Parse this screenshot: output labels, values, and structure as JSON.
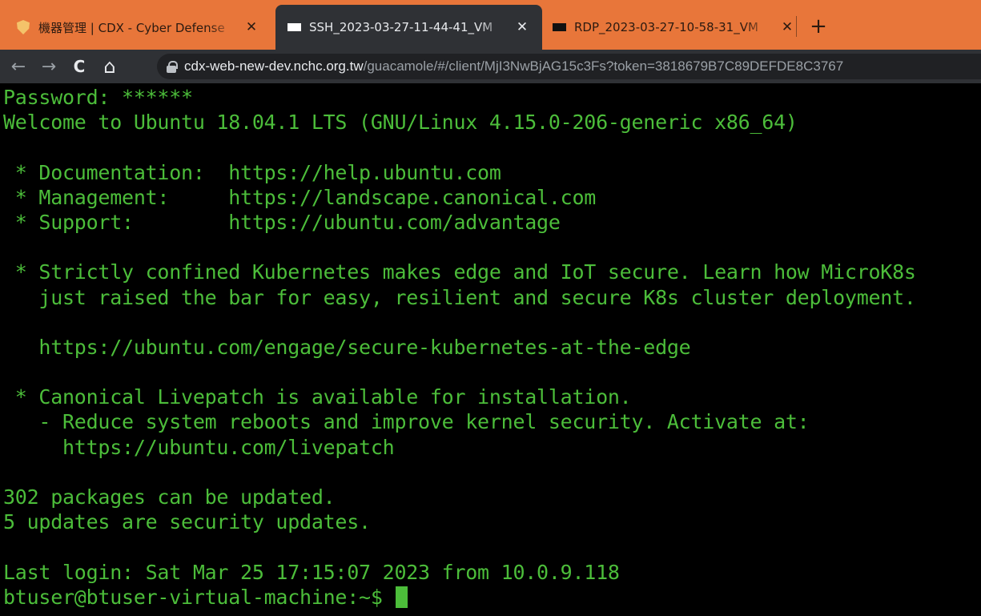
{
  "browser": {
    "tabs": [
      {
        "title": "機器管理 | CDX - Cyber Defense",
        "icon": "shield-icon",
        "active": false
      },
      {
        "title": "SSH_2023-03-27-11-44-41_VM",
        "icon": "terminal-icon",
        "active": true
      },
      {
        "title": "RDP_2023-03-27-10-58-31_VM",
        "icon": "terminal-icon",
        "active": false
      }
    ],
    "close_glyph": "✕",
    "new_tab_glyph": "+",
    "nav": {
      "back": "←",
      "forward": "→",
      "reload": "C",
      "home": "⌂"
    },
    "address": {
      "host": "cdx-web-new-dev.nchc.org.tw",
      "path": "/guacamole/#/client/MjI3NwBjAG15c3Fs?token=3818679B7C89DEFDE8C3767"
    },
    "colors": {
      "tabstrip": "#e8763a",
      "toolbar": "#2f3135",
      "terminal_fg": "#4cbd3a",
      "terminal_bg": "#000000"
    }
  },
  "terminal": {
    "lines": [
      "Password: ******",
      "Welcome to Ubuntu 18.04.1 LTS (GNU/Linux 4.15.0-206-generic x86_64)",
      "",
      " * Documentation:  https://help.ubuntu.com",
      " * Management:     https://landscape.canonical.com",
      " * Support:        https://ubuntu.com/advantage",
      "",
      " * Strictly confined Kubernetes makes edge and IoT secure. Learn how MicroK8s",
      "   just raised the bar for easy, resilient and secure K8s cluster deployment.",
      "",
      "   https://ubuntu.com/engage/secure-kubernetes-at-the-edge",
      "",
      " * Canonical Livepatch is available for installation.",
      "   - Reduce system reboots and improve kernel security. Activate at:",
      "     https://ubuntu.com/livepatch",
      "",
      "302 packages can be updated.",
      "5 updates are security updates.",
      "",
      "Last login: Sat Mar 25 17:15:07 2023 from 10.0.9.118"
    ],
    "prompt": "btuser@btuser-virtual-machine:~$ "
  }
}
